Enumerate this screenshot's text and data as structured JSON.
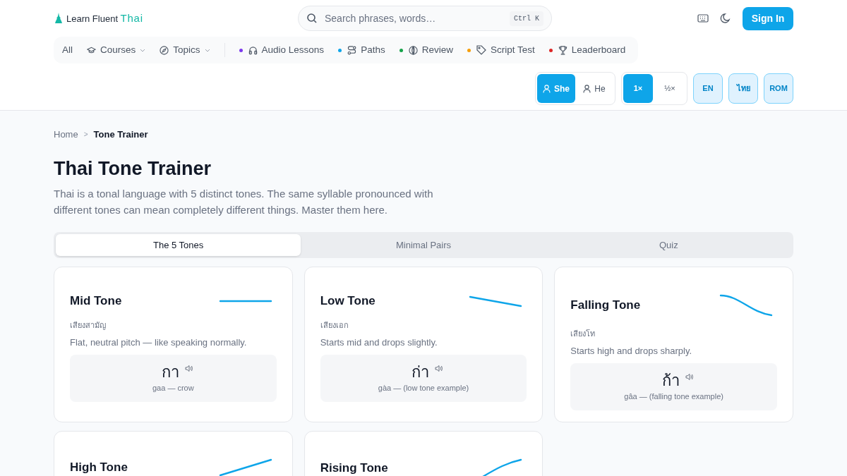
{
  "brand": {
    "name": "Learn Fluent",
    "accent": "Thai"
  },
  "search": {
    "placeholder": "Search phrases, words…",
    "shortcut": "Ctrl K"
  },
  "sign_in": "Sign In",
  "nav": [
    {
      "label": "All",
      "kind": "plain"
    },
    {
      "label": "Courses",
      "kind": "dropdown"
    },
    {
      "label": "Topics",
      "kind": "dropdown"
    },
    {
      "label": "Audio Lessons",
      "kind": "dot",
      "color": "#7c3aed"
    },
    {
      "label": "Paths",
      "kind": "dot",
      "color": "#0ea5e9"
    },
    {
      "label": "Review",
      "kind": "dot",
      "color": "#16a34a"
    },
    {
      "label": "Script Test",
      "kind": "dot",
      "color": "#f59e0b"
    },
    {
      "label": "Leaderboard",
      "kind": "dot",
      "color": "#dc2626"
    }
  ],
  "voice": [
    {
      "label": "She",
      "selected": true
    },
    {
      "label": "He",
      "selected": false
    }
  ],
  "speed": [
    {
      "label": "1×",
      "selected": true
    },
    {
      "label": "½×",
      "selected": false
    }
  ],
  "script_toggles": [
    {
      "label": "EN",
      "on": true
    },
    {
      "label": "ไทย",
      "on": true
    },
    {
      "label": "ROM",
      "on": true
    }
  ],
  "breadcrumb": {
    "items": [
      "Home",
      "Tone Trainer"
    ],
    "separator": ">"
  },
  "title": "Thai Tone Trainer",
  "intro": "Thai is a tonal language with 5 distinct tones. The same syllable pronounced with different tones can mean completely different things. Master them here.",
  "tabs": [
    {
      "label": "The 5 Tones",
      "selected": true
    },
    {
      "label": "Minimal Pairs",
      "selected": false
    },
    {
      "label": "Quiz",
      "selected": false
    }
  ],
  "tones": [
    {
      "name": "Mid Tone",
      "kind": "flat",
      "thai_name": "เสียงสามัญ",
      "description": "Flat, neutral pitch — like speaking normally.",
      "example": "กา",
      "gloss": "gaa — crow"
    },
    {
      "name": "Low Tone",
      "kind": "low",
      "thai_name": "เสียงเอก",
      "description": "Starts mid and drops slightly.",
      "example": "ก่า",
      "gloss": "gàa — (low tone example)"
    },
    {
      "name": "Falling Tone",
      "kind": "falling",
      "thai_name": "เสียงโท",
      "description": "Starts high and drops sharply.",
      "example": "ก้า",
      "gloss": "gâa — (falling tone example)"
    },
    {
      "name": "High Tone",
      "kind": "high"
    },
    {
      "name": "Rising Tone",
      "kind": "rising"
    }
  ]
}
